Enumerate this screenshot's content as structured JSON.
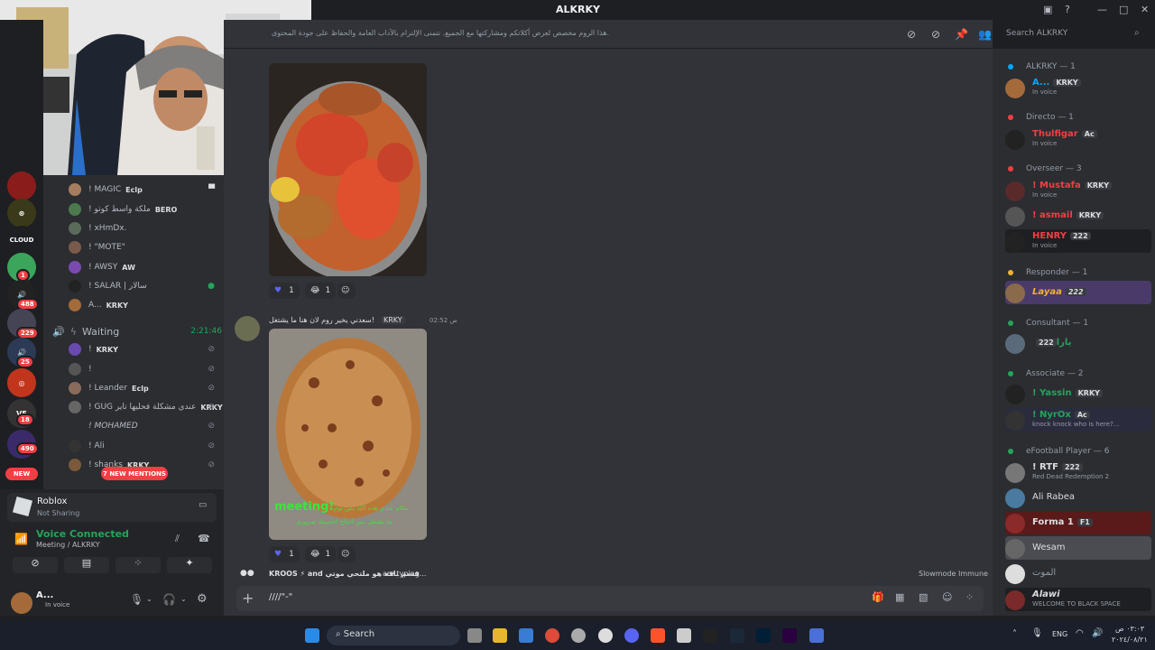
{
  "window": {
    "title": "ALKRKY"
  },
  "guilds": {
    "items": [
      {
        "name": "guild-1",
        "badge": ""
      },
      {
        "name": "guild-2",
        "badge": ""
      },
      {
        "name": "guild-cloud",
        "label": "CLOUD",
        "badge": ""
      },
      {
        "name": "guild-4",
        "badge": "1"
      },
      {
        "name": "guild-5",
        "badge": "488"
      },
      {
        "name": "guild-6",
        "badge": "229"
      },
      {
        "name": "guild-7",
        "badge": "25"
      },
      {
        "name": "guild-8",
        "badge": ""
      },
      {
        "name": "guild-9",
        "badge": "18"
      },
      {
        "name": "guild-10",
        "badge": "490"
      }
    ],
    "new_label": "NEW"
  },
  "voice_channel": {
    "top_members": [
      {
        "name": "! MAGIC",
        "tag": "Eclp"
      },
      {
        "name": "! ملكة واسط كوتو",
        "tag": "BERO"
      },
      {
        "name": "! xHmDx.",
        "tag": ""
      },
      {
        "name": "! \"MOTE\"",
        "tag": ""
      },
      {
        "name": "! AWSY",
        "tag": "AW"
      },
      {
        "name": "! SALAR | سالار",
        "tag": ""
      },
      {
        "name": "A...",
        "tag": "KRKY"
      }
    ],
    "waiting": {
      "name": "Waiting",
      "time": "2:21:46"
    },
    "waiting_members": [
      {
        "name": "!",
        "tag": "KRKY"
      },
      {
        "name": "!",
        "tag": ""
      },
      {
        "name": "! Leander",
        "tag": "Eclp"
      },
      {
        "name": "! GUG عندي مشكلة فحليها تاير",
        "tag": "KRKY"
      },
      {
        "name": "! MOHAMED",
        "tag": ""
      },
      {
        "name": "! Ali",
        "tag": ""
      },
      {
        "name": "! shanks",
        "tag": "KRKY"
      }
    ],
    "mentions_label": "7 NEW MENTIONS"
  },
  "activity": {
    "app": "Roblox",
    "status": "Not Sharing"
  },
  "voice_status": {
    "title": "Voice Connected",
    "channel": "Meeting / ALKRKY"
  },
  "user": {
    "name": "A...",
    "status": "In voice"
  },
  "topbar": {
    "topic": "هذا الروم مخصص لعرض أكلاتكم ومشاركتها مع الجميع. نتمنى الإلتزام بالآداب العامة والحفاظ على جودة المحتوى.",
    "search_placeholder": "Search ALKRKY"
  },
  "messages": [
    {
      "reaction_count_1": "1",
      "reaction_count_2": "1"
    },
    {
      "text": "سعدني يخير روم لان هنا ما يشتغل!",
      "tag": "KRKY",
      "time": "ص 02:52",
      "caption1": "سلام عندي هذه الله بس نوم",
      "caption2": "ما يشتغل بس احتاج احاسبك صروري",
      "caption_word": "meeting!",
      "reaction_count_1": "1",
      "reaction_count_2": "1"
    }
  ],
  "typing": {
    "users": "KROOS ⚡ and قسم باقه هو ملتحي موتي",
    "suffix": "are typing...",
    "slowmode": "Slowmode Immune"
  },
  "input": {
    "value": "////\"-\""
  },
  "members": {
    "categories": [
      {
        "label": "ALKRKY — 1",
        "color": "#23a55a"
      },
      {
        "label": "Directo — 1",
        "color": "#f23f43"
      },
      {
        "label": "Overseer — 3",
        "color": "#f23f43"
      },
      {
        "label": "Responder — 1",
        "color": "#f0b232"
      },
      {
        "label": "Consultant — 1",
        "color": "#23a55a"
      },
      {
        "label": "Associate — 2",
        "color": "#23a55a"
      },
      {
        "label": "eFootball Player — 6",
        "color": "#23a55a"
      }
    ],
    "list": [
      {
        "name": "A...",
        "tag": "KRKY",
        "sub": "In voice",
        "color": "#00a8fc"
      },
      {
        "name": "Thulfigar",
        "tag": "Ac",
        "sub": "In voice",
        "color": "#f23f43"
      },
      {
        "name": "! Mustafa",
        "tag": "KRKY",
        "sub": "In voice",
        "color": "#f23f43"
      },
      {
        "name": "! asmail",
        "tag": "KRKY",
        "sub": "",
        "color": "#f23f43"
      },
      {
        "name": "HENRY",
        "tag": "222",
        "sub": "In voice",
        "color": "#f23f43"
      },
      {
        "name": "Layaa",
        "tag": "222",
        "sub": "",
        "color": "#f0b232"
      },
      {
        "name": "يارا",
        "tag": "222",
        "sub": "",
        "color": "#23a55a"
      },
      {
        "name": "! Yassin",
        "tag": "KRKY",
        "sub": "",
        "color": "#23a55a"
      },
      {
        "name": "! NyrOx",
        "tag": "Ac",
        "sub": "knock knock who is here?...",
        "color": "#23a55a"
      },
      {
        "name": "! RTF",
        "tag": "222",
        "sub": "Red Dead Redemption 2",
        "color": "#dbdee1"
      },
      {
        "name": "Ali Rabea",
        "tag": "",
        "sub": "",
        "color": "#dbdee1"
      },
      {
        "name": "Forma 1",
        "tag": "F1",
        "sub": "",
        "color": "#dbdee1"
      },
      {
        "name": "Wesam",
        "tag": "",
        "sub": "",
        "color": "#dbdee1"
      },
      {
        "name": "الموت",
        "tag": "",
        "sub": "",
        "color": "#949ba4"
      },
      {
        "name": "Alawi",
        "tag": "",
        "sub": "WELCOME TO BLACK SPACE",
        "color": "#dbdee1"
      }
    ]
  },
  "taskbar": {
    "search": "Search",
    "lang": "ENG",
    "time": "٠٣:٠٣ ص",
    "date": "٢٠٢٤/٠٨/٢١"
  },
  "colors": {
    "accent": "#5865f2",
    "online": "#23a55a",
    "danger": "#f23f43"
  }
}
